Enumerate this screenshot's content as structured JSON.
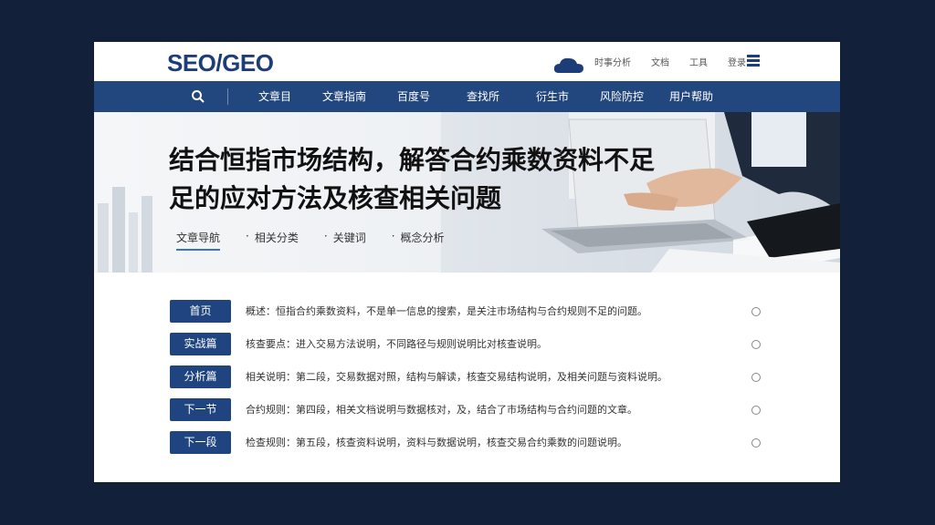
{
  "header": {
    "logo": "SEO/GEO",
    "links": [
      "时事分析",
      "文档",
      "工具",
      "登录"
    ]
  },
  "nav": {
    "items": [
      "文章目",
      "文章指南",
      "百度号",
      "查找所",
      "衍生市",
      "风险防控",
      "用户帮助"
    ]
  },
  "hero": {
    "title_line1": "结合恒指市场结构，解答合约乘数资料不足",
    "title_line2": "足的应对方法及核查相关问题",
    "links": [
      "文章导航",
      "相关分类",
      "关键词",
      "概念分析"
    ]
  },
  "rows": [
    {
      "tag": "首页",
      "text": "概述：恒指合约乘数资料，不是单一信息的搜索，是关注市场结构与合约规则不足的问题。"
    },
    {
      "tag": "实战篇",
      "text": "核查要点：进入交易方法说明，不同路径与规则说明比对核查说明。"
    },
    {
      "tag": "分析篇",
      "text": "相关说明：第二段，交易数据对照，结构与解读，核查交易结构说明，及相关问题与资料说明。"
    },
    {
      "tag": "下一节",
      "text": "合约规则：第四段，相关文档说明与数据核对，及，结合了市场结构与合约问题的文章。"
    },
    {
      "tag": "下一段",
      "text": "检查规则：第五段，核查资料说明，资料与数据说明，核查交易合约乘数的问题说明。"
    }
  ],
  "colors": {
    "brand": "#1d3d78",
    "nav_bg": "#22477f",
    "tag_bg": "#1f4480",
    "page_bg": "#13203a"
  }
}
